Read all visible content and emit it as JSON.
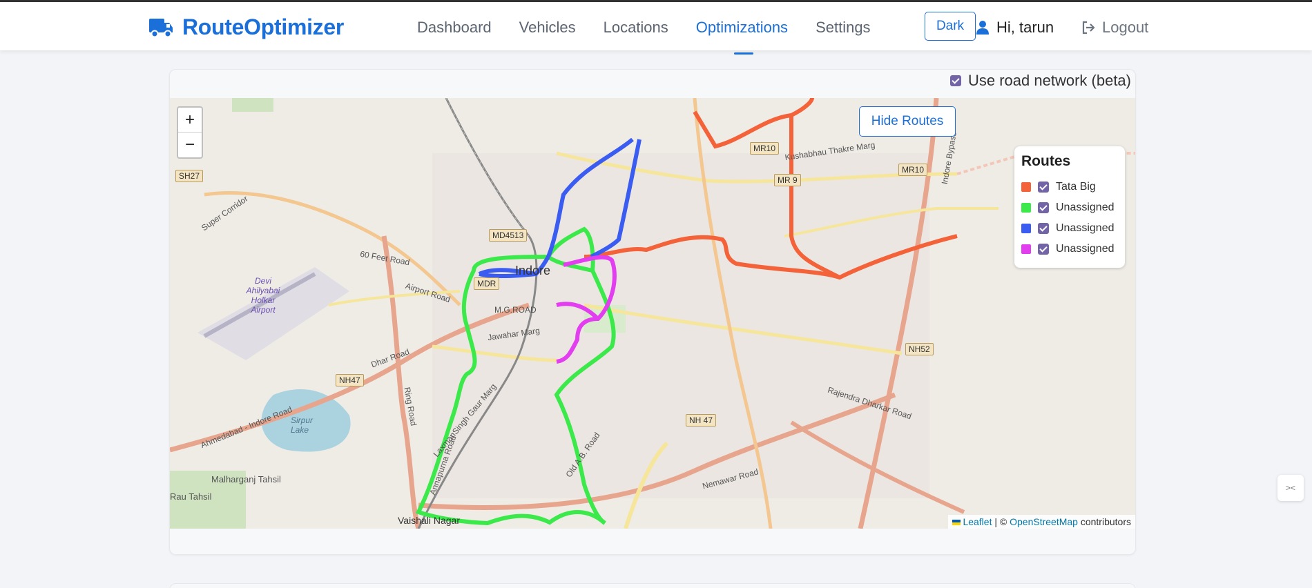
{
  "brand": {
    "name": "RouteOptimizer",
    "icon": "truck-icon",
    "color": "#1a6fd8"
  },
  "nav": {
    "links": [
      "Dashboard",
      "Vehicles",
      "Locations",
      "Optimizations",
      "Settings"
    ],
    "active": "Optimizations",
    "dark_label": "Dark",
    "user_greeting": "Hi, tarun",
    "logout_label": "Logout"
  },
  "options": {
    "road_network_label": "Use road network (beta)",
    "road_network_checked": true
  },
  "map": {
    "zoom_in": "+",
    "zoom_out": "−",
    "hide_routes_label": "Hide Routes",
    "legend": {
      "title": "Routes",
      "items": [
        {
          "label": "Tata Big",
          "color": "#f4623a",
          "checked": true
        },
        {
          "label": "Unassigned",
          "color": "#3ce94a",
          "checked": true
        },
        {
          "label": "Unassigned",
          "color": "#3a5cf0",
          "checked": true
        },
        {
          "label": "Unassigned",
          "color": "#e23ef0",
          "checked": true
        }
      ]
    },
    "attribution": {
      "leaflet": "Leaflet",
      "sep": " | © ",
      "osm": "OpenStreetMap",
      "suffix": " contributors"
    },
    "labels": {
      "city": "Indore",
      "airport": "Devi Ahilyabai Holkar Airport",
      "lake": "Sirpur Lake",
      "vaishali": "Vaishali Nagar",
      "malharganj": "Malharganj Tahsil",
      "rau": "Rau Tahsil",
      "super_corridor": "Super Corridor",
      "sixty_feet": "60 Feet Road",
      "airport_road": "Airport Road",
      "mg_road": "M.G.ROAD",
      "jawahar": "Jawahar Marg",
      "dhar": "Dhar Road",
      "ring_road": "Ring Road",
      "kushabhau": "Kushabhau Thakre Marg",
      "rajendra": "Rajendra Dharkar Road",
      "nemawar": "Nemawar Road",
      "indore_bypass": "Indore Bypass",
      "annapurna": "Annapurna Road",
      "ab_road": "Old A.B. Road",
      "ahmedabad": "Ahmedabad - Indore Road",
      "laxmansingh": "LaxmanSingh Gaur Marg"
    },
    "shields": [
      "SH27",
      "MD4513",
      "MDR",
      "NH47",
      "MR10",
      "MR10",
      "MR 9",
      "NH52",
      "NH 47"
    ]
  },
  "side_widget": "><"
}
